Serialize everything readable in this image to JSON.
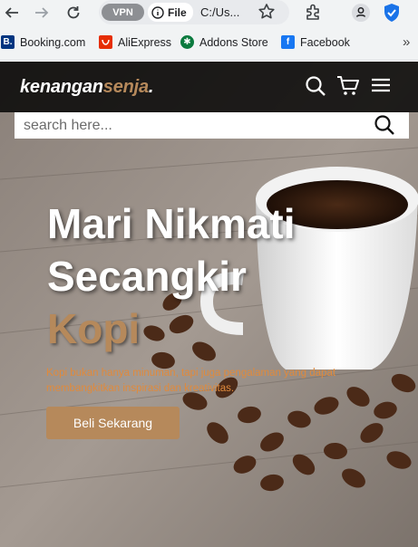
{
  "browser": {
    "vpn_label": "VPN",
    "site_info_label": "File",
    "url": "C:/Us...",
    "icons": [
      "back-icon",
      "forward-icon",
      "reload-icon",
      "info-icon",
      "star-icon",
      "extensions-icon",
      "profile-icon",
      "shield-icon"
    ],
    "bookmarks": [
      {
        "label": "Booking.com",
        "icon": "booking-icon",
        "color": "#003580",
        "glyph": "B."
      },
      {
        "label": "AliExpress",
        "icon": "aliexpress-icon",
        "color": "#e62e04",
        "glyph": "A"
      },
      {
        "label": "Addons Store",
        "icon": "addons-icon",
        "color": "#0b7a3e",
        "glyph": "✱"
      },
      {
        "label": "Facebook",
        "icon": "facebook-icon",
        "color": "#1877f2",
        "glyph": "f"
      }
    ],
    "more_label": "»"
  },
  "site": {
    "logo_main": "kenangan",
    "logo_accent": "senja",
    "logo_dot": ".",
    "accent_color": "#b6895b",
    "search": {
      "placeholder": "search here..."
    },
    "hero": {
      "title_line1": "Mari Nikmati",
      "title_line2": "Secangkir",
      "title_accent": "Kopi",
      "description": "Kopi bukan hanya minuman, tapi juga pengalaman yang dapat membangkitkan inspirasi dan kreativitas.",
      "cta_label": "Beli Sekarang"
    }
  }
}
